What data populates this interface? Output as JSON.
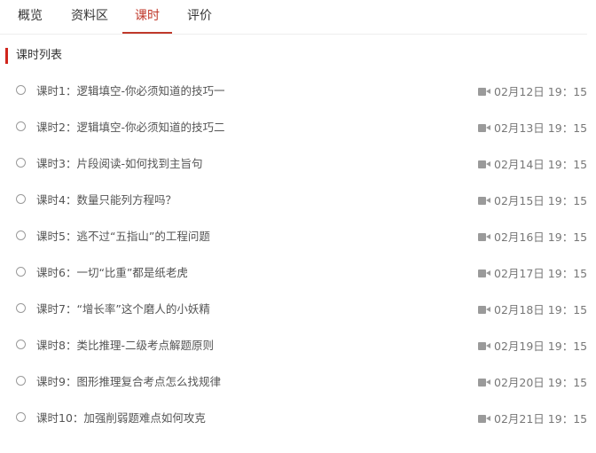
{
  "tabs": [
    {
      "label": "概览",
      "active": false
    },
    {
      "label": "资料区",
      "active": false
    },
    {
      "label": "课时",
      "active": true
    },
    {
      "label": "评价",
      "active": false
    }
  ],
  "section_title": "课时列表",
  "lessons": [
    {
      "title": "课时1：逻辑填空-你必须知道的技巧一",
      "time": "02月12日 19：15"
    },
    {
      "title": "课时2：逻辑填空-你必须知道的技巧二",
      "time": "02月13日 19：15"
    },
    {
      "title": "课时3：片段阅读-如何找到主旨句",
      "time": "02月14日 19：15"
    },
    {
      "title": "课时4：数量只能列方程吗？",
      "time": "02月15日 19：15"
    },
    {
      "title": "课时5：逃不过“五指山”的工程问题",
      "time": "02月16日 19：15"
    },
    {
      "title": "课时6：一切“比重”都是纸老虎",
      "time": "02月17日 19：15"
    },
    {
      "title": "课时7：“增长率”这个磨人的小妖精",
      "time": "02月18日 19：15"
    },
    {
      "title": "课时8：类比推理-二级考点解题原则",
      "time": "02月19日 19：15"
    },
    {
      "title": "课时9：图形推理复合考点怎么找规律",
      "time": "02月20日 19：15"
    },
    {
      "title": "课时10：加强削弱题难点如何攻克",
      "time": "02月21日 19：15"
    }
  ],
  "icons": {
    "lesson_marker": "radio-circle-icon",
    "lesson_type": "video-camera-icon"
  },
  "colors": {
    "accent": "#c0392b",
    "section_bar": "#d0251c",
    "icon_gray": "#9a9a9a"
  }
}
